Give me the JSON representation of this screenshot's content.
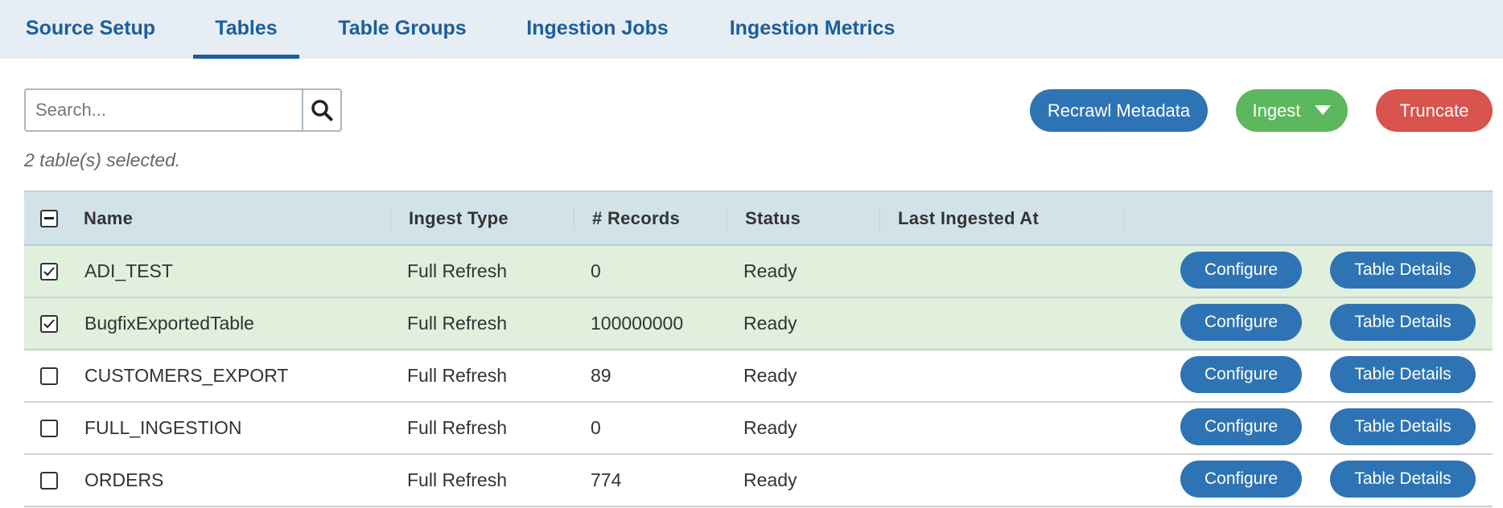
{
  "tabs": [
    {
      "label": "Source Setup",
      "active": false
    },
    {
      "label": "Tables",
      "active": true
    },
    {
      "label": "Table Groups",
      "active": false
    },
    {
      "label": "Ingestion Jobs",
      "active": false
    },
    {
      "label": "Ingestion Metrics",
      "active": false
    }
  ],
  "search": {
    "placeholder": "Search...",
    "value": ""
  },
  "actions": {
    "recrawl_label": "Recrawl Metadata",
    "ingest_label": "Ingest",
    "truncate_label": "Truncate"
  },
  "selection_text": "2 table(s) selected.",
  "table": {
    "headers": {
      "name": "Name",
      "ingest_type": "Ingest Type",
      "records": "# Records",
      "status": "Status",
      "last_ingested": "Last Ingested At"
    },
    "rows": [
      {
        "selected": true,
        "name": "ADI_TEST",
        "ingest_type": "Full Refresh",
        "records": "0",
        "status": "Ready",
        "last_ingested": "",
        "configure": "Configure",
        "details": "Table Details"
      },
      {
        "selected": true,
        "name": "BugfixExportedTable",
        "ingest_type": "Full Refresh",
        "records": "100000000",
        "status": "Ready",
        "last_ingested": "",
        "configure": "Configure",
        "details": "Table Details"
      },
      {
        "selected": false,
        "name": "CUSTOMERS_EXPORT",
        "ingest_type": "Full Refresh",
        "records": "89",
        "status": "Ready",
        "last_ingested": "",
        "configure": "Configure",
        "details": "Table Details"
      },
      {
        "selected": false,
        "name": "FULL_INGESTION",
        "ingest_type": "Full Refresh",
        "records": "0",
        "status": "Ready",
        "last_ingested": "",
        "configure": "Configure",
        "details": "Table Details"
      },
      {
        "selected": false,
        "name": "ORDERS",
        "ingest_type": "Full Refresh",
        "records": "774",
        "status": "Ready",
        "last_ingested": "",
        "configure": "Configure",
        "details": "Table Details"
      }
    ]
  },
  "colors": {
    "primary": "#2e74b5",
    "success": "#5cb85c",
    "danger": "#d9534f",
    "tab_text": "#1b5e9c",
    "selected_row": "#e0f0dd",
    "header_bg": "#d1e3e9"
  },
  "icons": {
    "search": "search-icon",
    "ingest_dropdown": "caret-down-icon",
    "header_checkbox": "indeterminate-checkbox-icon",
    "row_checked": "checkmark-icon"
  }
}
